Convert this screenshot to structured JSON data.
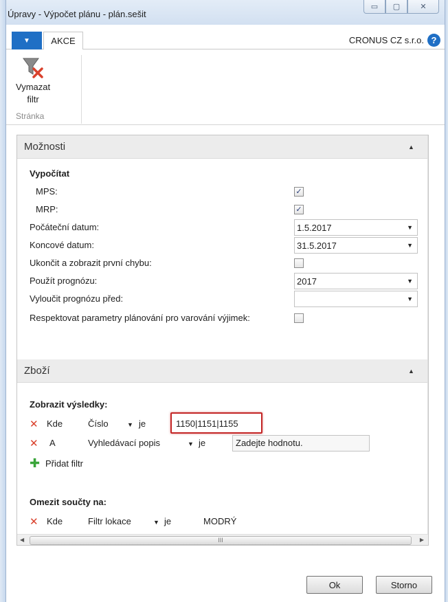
{
  "window": {
    "title": "Úpravy - Výpočet plánu - plán.sešit",
    "minimize": "▭",
    "maximize": "▢",
    "close": "✕"
  },
  "ribbon": {
    "menu_icon": "▼",
    "tab_akce": "AKCE",
    "company": "CRONUS CZ s.r.o.",
    "help": "?",
    "clear_filter_line1": "Vymazat",
    "clear_filter_line2": "filtr",
    "group_label": "Stránka"
  },
  "options": {
    "header": "Možnosti",
    "calculate_label": "Vypočítat",
    "mps_label": "MPS:",
    "mps_checked": true,
    "mrp_label": "MRP:",
    "mrp_checked": true,
    "start_date_label": "Počáteční datum:",
    "start_date": "1.5.2017",
    "end_date_label": "Koncové datum:",
    "end_date": "31.5.2017",
    "stop_first_error_label": "Ukončit a zobrazit první chybu:",
    "stop_first_error_checked": false,
    "use_forecast_label": "Použít prognózu:",
    "use_forecast": "2017",
    "exclude_forecast_label": "Vyloučit prognózu před:",
    "exclude_forecast": "",
    "respect_params_label": "Respektovat parametry plánování pro varování výjimek:",
    "respect_params_checked": false
  },
  "items": {
    "header": "Zboží",
    "show_results_label": "Zobrazit výsledky:",
    "filters": [
      {
        "conj": "Kde",
        "field": "Číslo",
        "op": "je",
        "value": "1150|1151|1155"
      },
      {
        "conj": "A",
        "field": "Vyhledávací popis",
        "op": "je",
        "value": "Zadejte hodnotu."
      }
    ],
    "add_filter": "Přidat filtr",
    "limit_totals_label": "Omezit součty na:",
    "limit_filter": {
      "conj": "Kde",
      "field": "Filtr lokace",
      "op": "je",
      "value": "MODRÝ"
    }
  },
  "scroll": {
    "up": "▲",
    "down": "▼",
    "left": "◀",
    "right": "▶",
    "grip": "≡",
    "hgrip": "III"
  },
  "buttons": {
    "ok": "Ok",
    "cancel": "Storno"
  },
  "icons": {
    "close_x": "✕",
    "plus": "✚",
    "chevron_up": "▲",
    "dropdown": "▼",
    "check": "✓"
  }
}
